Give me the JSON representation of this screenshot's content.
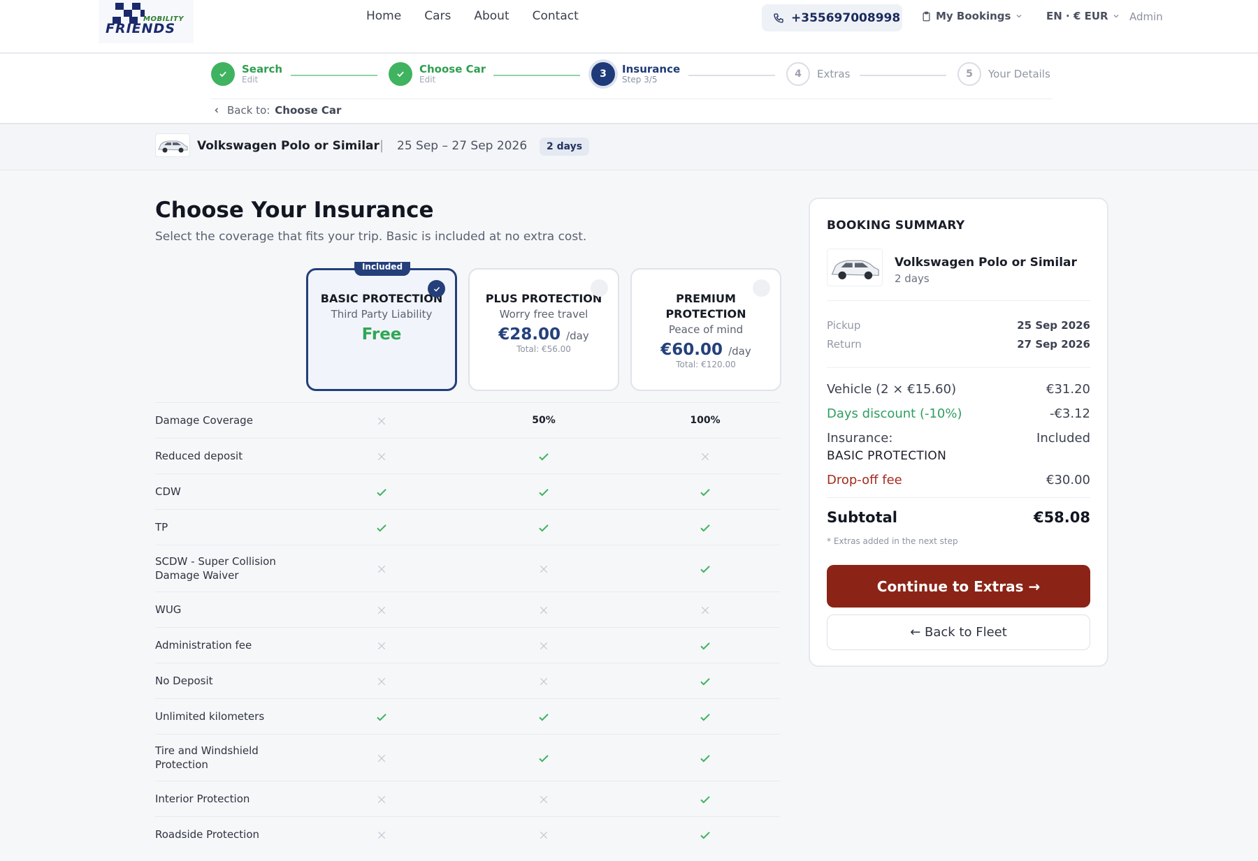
{
  "brand": {
    "logo_text": "FRIENDS",
    "logo_subtext": "MOBILITY"
  },
  "nav": [
    "Home",
    "Cars",
    "About",
    "Contact"
  ],
  "header": {
    "phone": "+355697008998",
    "my_bookings": "My Bookings",
    "lang_currency": "EN · € EUR",
    "admin": "Admin"
  },
  "steps": [
    {
      "num": "1",
      "title": "Search",
      "sub": "Edit",
      "state": "done"
    },
    {
      "num": "2",
      "title": "Choose Car",
      "sub": "Edit",
      "state": "done"
    },
    {
      "num": "3",
      "title": "Insurance",
      "sub": "Step 3/5",
      "state": "active"
    },
    {
      "num": "4",
      "title": "Extras",
      "sub": "",
      "state": "todo"
    },
    {
      "num": "5",
      "title": "Your Details",
      "sub": "",
      "state": "todo"
    }
  ],
  "back_link": {
    "prefix": "Back to:",
    "target": "Choose Car"
  },
  "car_strip": {
    "name": "Volkswagen Polo or Similar",
    "dates": "25 Sep – 27 Sep 2026",
    "days": "2 days"
  },
  "page": {
    "title": "Choose Your Insurance",
    "subtitle": "Select the coverage that fits your trip. Basic is included at no extra cost."
  },
  "plans": [
    {
      "name": "BASIC PROTECTION",
      "tagline": "Third Party Liability",
      "price": "Free",
      "badge": "Included",
      "selected": true
    },
    {
      "name": "PLUS PROTECTION",
      "tagline": "Worry free travel",
      "price": "€28.00",
      "per": "/day",
      "total": "Total: €56.00",
      "selected": false
    },
    {
      "name": "PREMIUM PROTECTION",
      "tagline": "Peace of mind",
      "price": "€60.00",
      "per": "/day",
      "total": "Total: €120.00",
      "selected": false
    }
  ],
  "features": [
    {
      "label": "Damage Coverage",
      "values": [
        "no",
        "50%",
        "100%"
      ]
    },
    {
      "label": "Reduced deposit",
      "values": [
        "no",
        "yes",
        "no"
      ]
    },
    {
      "label": "CDW",
      "values": [
        "yes",
        "yes",
        "yes"
      ]
    },
    {
      "label": "TP",
      "values": [
        "yes",
        "yes",
        "yes"
      ]
    },
    {
      "label": "SCDW - Super Collision Damage Waiver",
      "values": [
        "no",
        "no",
        "yes"
      ]
    },
    {
      "label": "WUG",
      "values": [
        "no",
        "no",
        "no"
      ]
    },
    {
      "label": "Administration fee",
      "values": [
        "no",
        "no",
        "yes"
      ]
    },
    {
      "label": "No Deposit",
      "values": [
        "no",
        "no",
        "yes"
      ]
    },
    {
      "label": "Unlimited kilometers",
      "values": [
        "yes",
        "yes",
        "yes"
      ]
    },
    {
      "label": "Tire and Windshield Protection",
      "values": [
        "no",
        "yes",
        "yes"
      ]
    },
    {
      "label": "Interior Protection",
      "values": [
        "no",
        "no",
        "yes"
      ]
    },
    {
      "label": "Roadside Protection",
      "values": [
        "no",
        "no",
        "yes"
      ]
    }
  ],
  "summary": {
    "heading": "BOOKING SUMMARY",
    "car": "Volkswagen Polo or Similar",
    "days": "2 days",
    "pickup_label": "Pickup",
    "pickup": "25 Sep 2026",
    "return_label": "Return",
    "return": "27 Sep 2026",
    "vehicle_label": "Vehicle (2 × €15.60)",
    "vehicle": "€31.20",
    "discount_label": "Days discount (-10%)",
    "discount": "-€3.12",
    "insurance_label": "Insurance:",
    "insurance": "Included",
    "insurance_name": "BASIC PROTECTION",
    "dropoff_label": "Drop-off fee",
    "dropoff": "€30.00",
    "subtotal_label": "Subtotal",
    "subtotal": "€58.08",
    "note": "* Extras added in the next step",
    "continue": "Continue to Extras →",
    "back": "← Back to Fleet"
  },
  "colors": {
    "primary": "#243f7a",
    "accent": "#8b2416",
    "success": "#32a654"
  }
}
